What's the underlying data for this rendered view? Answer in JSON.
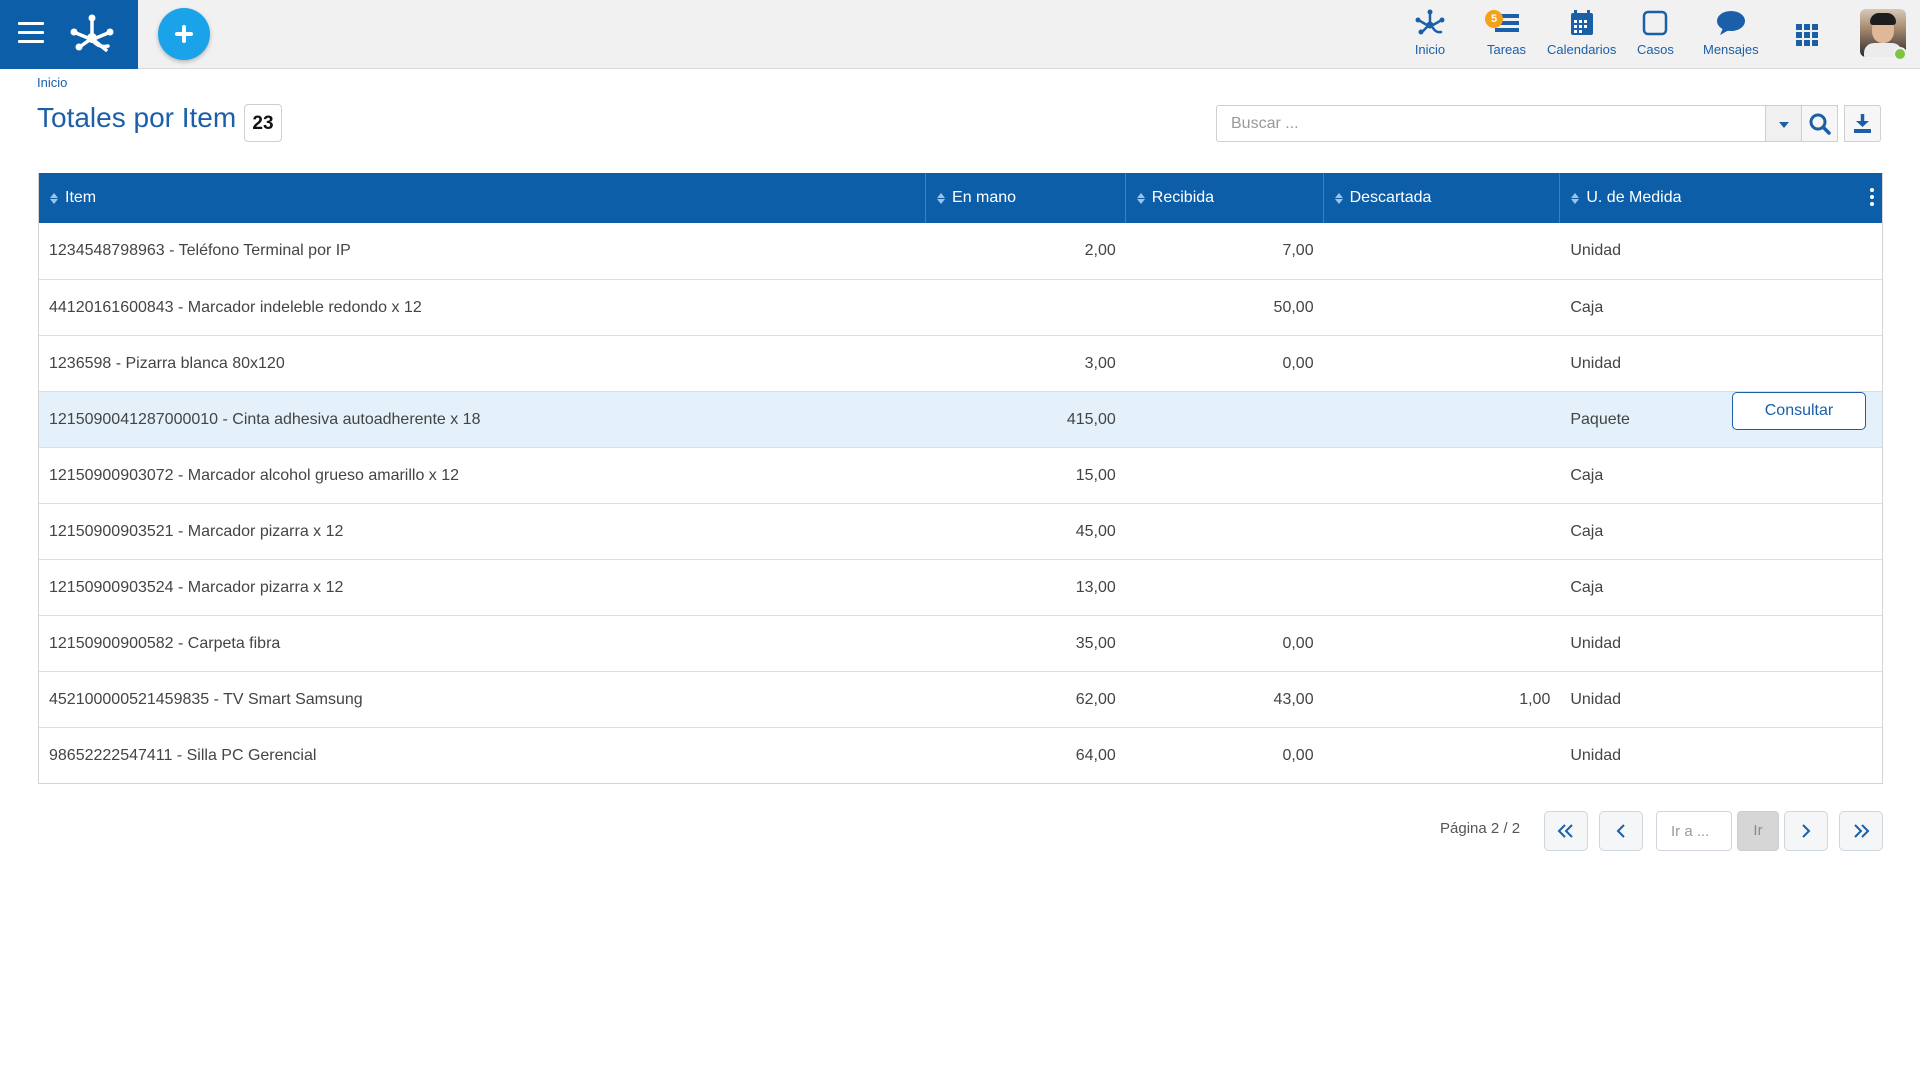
{
  "colors": {
    "brand": "#0c5ea8",
    "accent": "#1aa3e8",
    "link": "#1b5fa8",
    "badge": "#f4a21a",
    "online": "#7dc443",
    "selected_row": "#e4f1fa"
  },
  "topbar": {
    "nav": [
      {
        "label": "Inicio",
        "icon": "home-tree-icon"
      },
      {
        "label": "Tareas",
        "icon": "tasks-icon",
        "badge": "5"
      },
      {
        "label": "Calendarios",
        "icon": "calendar-icon"
      },
      {
        "label": "Casos",
        "icon": "cases-icon"
      },
      {
        "label": "Mensajes",
        "icon": "chat-bubble-icon"
      }
    ],
    "apps_icon": "grid-apps-icon",
    "avatar_status": "online"
  },
  "breadcrumb": "Inicio",
  "page": {
    "title": "Totales por Item",
    "count": "23"
  },
  "search": {
    "placeholder": "Buscar ..."
  },
  "table": {
    "columns": [
      "Item",
      "En mano",
      "Recibida",
      "Descartada",
      "U. de Medida"
    ],
    "rows": [
      {
        "item": "1234548798963 - Teléfono Terminal por IP",
        "en_mano": "2,00",
        "recibida": "7,00",
        "descartada": "",
        "unidad": "Unidad"
      },
      {
        "item": "44120161600843 - Marcador indeleble redondo x 12",
        "en_mano": "",
        "recibida": "50,00",
        "descartada": "",
        "unidad": "Caja"
      },
      {
        "item": "1236598 - Pizarra blanca 80x120",
        "en_mano": "3,00",
        "recibida": "0,00",
        "descartada": "",
        "unidad": "Unidad"
      },
      {
        "item": "1215090041287000010 - Cinta adhesiva autoadherente x 18",
        "en_mano": "415,00",
        "recibida": "",
        "descartada": "",
        "unidad": "Paquete",
        "selected": true
      },
      {
        "item": "12150900903072 - Marcador alcohol grueso amarillo x 12",
        "en_mano": "15,00",
        "recibida": "",
        "descartada": "",
        "unidad": "Caja"
      },
      {
        "item": "12150900903521 - Marcador pizarra x 12",
        "en_mano": "45,00",
        "recibida": "",
        "descartada": "",
        "unidad": "Caja"
      },
      {
        "item": "12150900903524 - Marcador pizarra x 12",
        "en_mano": "13,00",
        "recibida": "",
        "descartada": "",
        "unidad": "Caja"
      },
      {
        "item": "12150900900582 - Carpeta fibra",
        "en_mano": "35,00",
        "recibida": "0,00",
        "descartada": "",
        "unidad": "Unidad"
      },
      {
        "item": "452100000521459835 - TV Smart Samsung",
        "en_mano": "62,00",
        "recibida": "43,00",
        "descartada": "1,00",
        "unidad": "Unidad"
      },
      {
        "item": "98652222547411 - Silla PC Gerencial",
        "en_mano": "64,00",
        "recibida": "0,00",
        "descartada": "",
        "unidad": "Unidad"
      }
    ],
    "row_action": "Consultar"
  },
  "pagination": {
    "info": "Página 2 / 2",
    "goto_placeholder": "Ir a ...",
    "goto_label": "Ir"
  }
}
